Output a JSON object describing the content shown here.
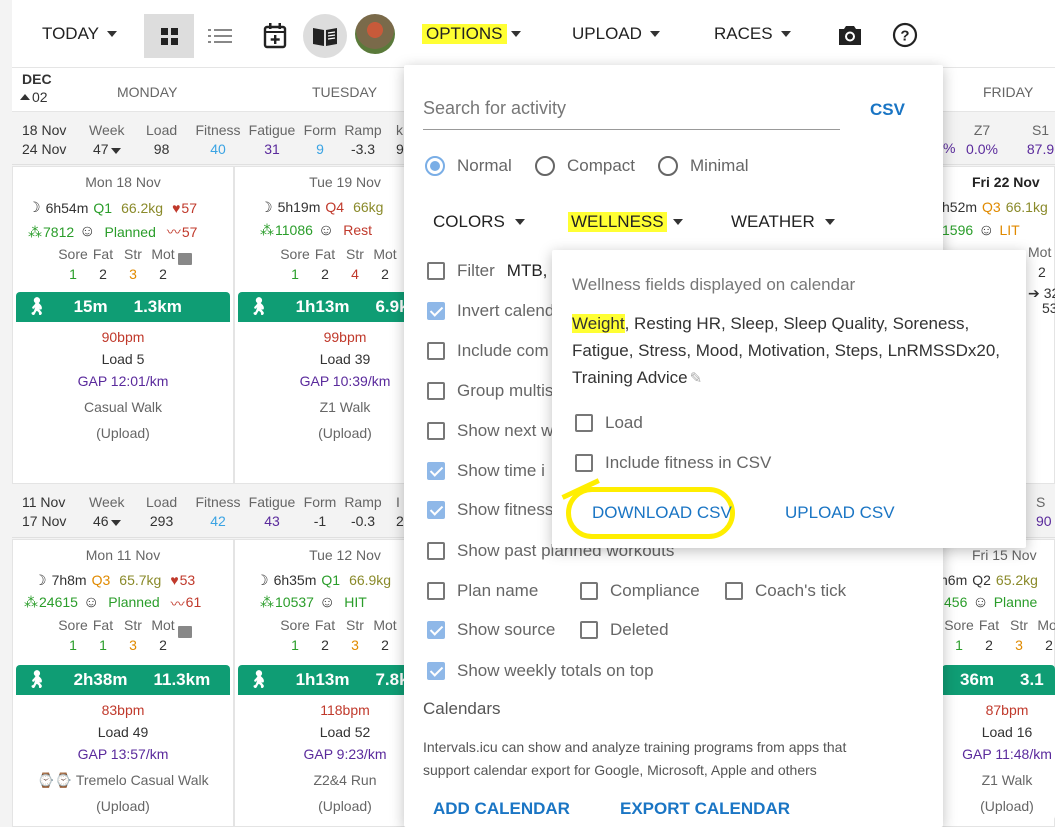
{
  "toolbar": {
    "today": "TODAY",
    "options": "OPTIONS",
    "upload": "UPLOAD",
    "races": "RACES"
  },
  "calendar": {
    "month": "DEC",
    "day": "02",
    "days": [
      "MONDAY",
      "TUESDAY",
      "FRIDAY"
    ],
    "weeks": [
      {
        "from": "18 Nov",
        "to": "24 Nov",
        "week_lbl": "Week",
        "week": "47",
        "load_lbl": "Load",
        "load": "98",
        "fitness_lbl": "Fitness",
        "fitness": "40",
        "fatigue_lbl": "Fatigue",
        "fatigue": "31",
        "form_lbl": "Form",
        "form": "9",
        "ramp_lbl": "Ramp",
        "ramp": "-3.3",
        "cut": "k",
        "cut2": "9",
        "z7_lbl": "Z7",
        "z7": "0.0%",
        "s1_lbl": "S1",
        "s1": "87.9",
        "pct": "%"
      },
      {
        "from": "11 Nov",
        "to": "17 Nov",
        "week_lbl": "Week",
        "week": "46",
        "load_lbl": "Load",
        "load": "293",
        "fitness_lbl": "Fitness",
        "fitness": "42",
        "fatigue_lbl": "Fatigue",
        "fatigue": "43",
        "form_lbl": "Form",
        "form": "-1",
        "ramp_lbl": "Ramp",
        "ramp": "-0.3",
        "cut": "I",
        "cut2": "2",
        "s_lbl": "S",
        "s": "90"
      }
    ],
    "cells": [
      {
        "date": "Mon 18 Nov",
        "sleep": "6h54m",
        "q": "Q1",
        "weight": "66.2kg",
        "hr": "57",
        "steps": "7812",
        "status": "Planned",
        "hrv": "57",
        "sore": "1",
        "fat": "2",
        "str": "3",
        "mot": "2",
        "act": {
          "time": "15m",
          "dist": "1.3km",
          "bpm": "90bpm",
          "load": "Load 5",
          "gap": "GAP 12:01/km",
          "name": "Casual Walk",
          "src": "(Upload)"
        }
      },
      {
        "date": "Tue 19 Nov",
        "sleep": "5h19m",
        "q": "Q4",
        "weight": "66kg",
        "steps": "11086",
        "status": "Rest",
        "sore": "1",
        "fat": "2",
        "str": "4",
        "mot": "2",
        "act": {
          "time": "1h13m",
          "dist": "6.9k",
          "bpm": "99bpm",
          "load": "Load 39",
          "gap": "GAP 10:39/km",
          "name": "Z1 Walk",
          "src": "(Upload)"
        }
      },
      {
        "date": "Fri 22 Nov",
        "sleep": "h52m",
        "q": "Q3",
        "weight": "66.1kg",
        "steps": "1596",
        "status": "LIT",
        "mot_lbl": "Mot",
        "mot": "2",
        "extra1": "32",
        "extra2": "53"
      },
      {
        "date": "Mon 11 Nov",
        "sleep": "7h8m",
        "q": "Q3",
        "weight": "65.7kg",
        "hr": "53",
        "steps": "24615",
        "status": "Planned",
        "hrv": "61",
        "sore": "1",
        "fat": "1",
        "str": "3",
        "mot": "2",
        "act": {
          "time": "2h38m",
          "dist": "11.3km",
          "bpm": "83bpm",
          "load": "Load 49",
          "gap": "GAP 13:57/km",
          "name": "Tremelo Casual Walk",
          "src": "(Upload)"
        }
      },
      {
        "date": "Tue 12 Nov",
        "sleep": "6h35m",
        "q": "Q1",
        "weight": "66.9kg",
        "steps": "10537",
        "status": "HIT",
        "sore": "1",
        "fat": "2",
        "str": "3",
        "mot": "2",
        "act": {
          "time": "1h13m",
          "dist": "7.8k",
          "bpm": "118bpm",
          "load": "Load 52",
          "gap": "GAP 9:23/km",
          "name": "Z2&4 Run",
          "src": "(Upload)"
        }
      },
      {
        "date": "Fri 15 Nov",
        "sleep": "h6m",
        "q": "Q2",
        "weight": "65.2kg",
        "steps": "456",
        "status": "Planne",
        "sore": "1",
        "fat": "2",
        "str": "3",
        "mot": "2",
        "act": {
          "time": "36m",
          "dist": "3.1",
          "bpm": "87bpm",
          "load": "Load 16",
          "gap": "GAP 11:48/km",
          "name": "Z1 Walk",
          "src": "(Upload)"
        }
      }
    ],
    "hdr_sore": "Sore",
    "hdr_fat": "Fat",
    "hdr_str": "Str",
    "hdr_mot": "Mot"
  },
  "options": {
    "search_placeholder": "Search for activity",
    "csv": "CSV",
    "modes": [
      "Normal",
      "Compact",
      "Minimal"
    ],
    "colors": "COLORS",
    "wellness": "WELLNESS",
    "weather": "WEATHER",
    "filter": "Filter",
    "filter_val": "MTB,",
    "checks": [
      "Invert calend",
      "Include com",
      "Group multis",
      "Show next w",
      "Show time i",
      "Show fitness",
      "Show past planned workouts"
    ],
    "plan_name": "Plan name",
    "compliance": "Compliance",
    "coach_tick": "Coach's tick",
    "show_source": "Show source",
    "deleted": "Deleted",
    "weekly_totals": "Show weekly totals on top",
    "calendars_title": "Calendars",
    "calendars_desc1": "Intervals.icu can show and analyze training programs from apps that",
    "calendars_desc2": "support calendar export for Google, Microsoft, Apple and others",
    "add_calendar": "ADD CALENDAR",
    "export_calendar": "EXPORT CALENDAR"
  },
  "wellness": {
    "title": "Wellness fields displayed on calendar",
    "weight": "Weight",
    "fields_line1": ", Resting HR, Sleep, Sleep Quality, Soreness,",
    "fields_line2": "Fatigue, Stress, Mood, Motivation, Steps, LnRMSSDx20,",
    "fields_line3": "Training Advice",
    "load": "Load",
    "include_fitness": "Include fitness in CSV",
    "download": "DOWNLOAD CSV",
    "upload": "UPLOAD CSV"
  },
  "colors": {
    "accent": "#0f9d74",
    "link": "#1a75c4",
    "highlight": "#ffff33"
  }
}
